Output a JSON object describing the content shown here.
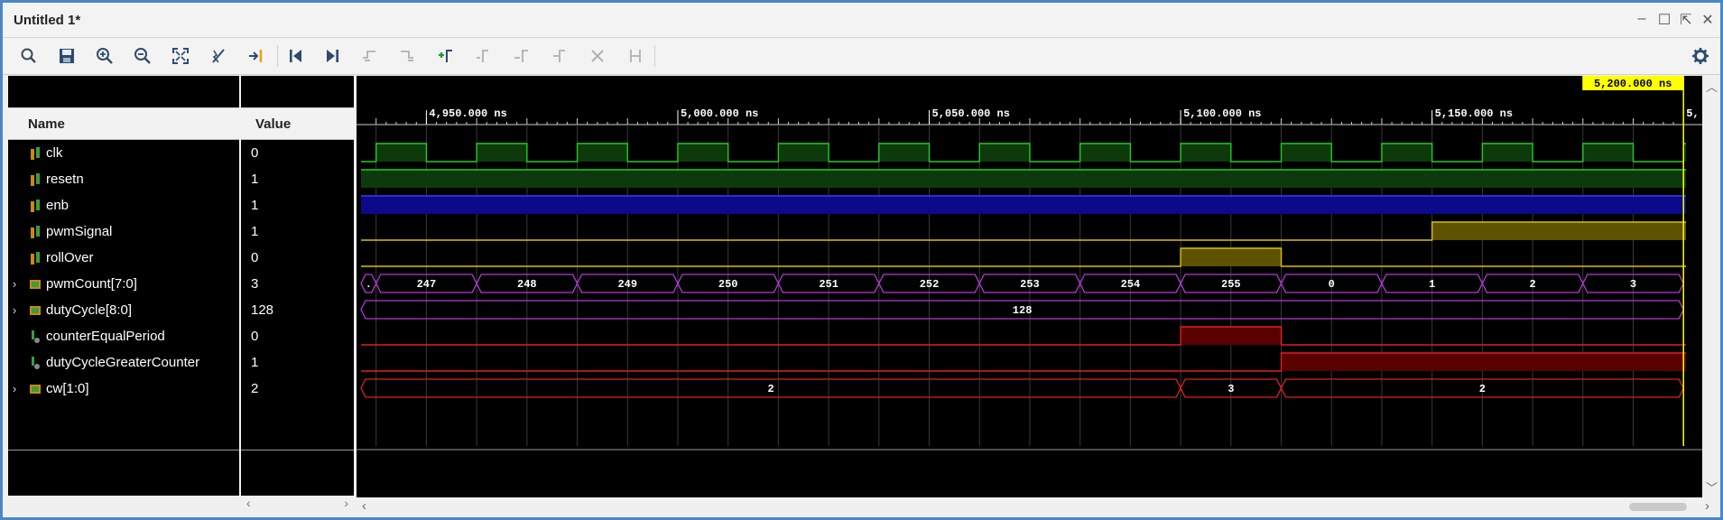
{
  "window": {
    "title": "Untitled 1*",
    "controls": {
      "minimize": "–",
      "restore": "☐",
      "popout": "⇱",
      "close": "✕"
    }
  },
  "toolbar": {
    "buttons": [
      {
        "name": "search-button",
        "icon": "search-icon"
      },
      {
        "name": "save-button",
        "icon": "save-icon"
      },
      {
        "name": "zoom-in-button",
        "icon": "zoom-in-icon"
      },
      {
        "name": "zoom-out-button",
        "icon": "zoom-out-icon"
      },
      {
        "name": "zoom-fit-button",
        "icon": "zoom-fit-icon"
      },
      {
        "name": "snap-transitions-button",
        "icon": "snap-icon"
      },
      {
        "name": "go-to-cursor-button",
        "icon": "goto-cursor-icon"
      },
      {
        "name": "go-to-time-0-button",
        "icon": "goto-start-icon"
      },
      {
        "name": "go-to-last-time-button",
        "icon": "goto-end-icon"
      },
      {
        "name": "previous-transition-button",
        "icon": "prev-transition-icon"
      },
      {
        "name": "next-transition-button",
        "icon": "next-transition-icon"
      },
      {
        "name": "add-marker-button",
        "icon": "add-marker-icon"
      },
      {
        "name": "previous-marker-button",
        "icon": "prev-marker-icon"
      },
      {
        "name": "next-marker-button",
        "icon": "next-marker-icon"
      },
      {
        "name": "swap-cursors-button",
        "icon": "swap-cursors-icon"
      },
      {
        "name": "delete-button",
        "icon": "x-icon"
      },
      {
        "name": "fix-markers-button",
        "icon": "fix-markers-icon"
      }
    ],
    "settings_icon": "gear-icon"
  },
  "panes": {
    "name_header": "Name",
    "value_header": "Value"
  },
  "signals": [
    {
      "name": "clk",
      "value": "0",
      "kind": "bit",
      "expandable": false
    },
    {
      "name": "resetn",
      "value": "1",
      "kind": "bit",
      "expandable": false
    },
    {
      "name": "enb",
      "value": "1",
      "kind": "bit",
      "expandable": false
    },
    {
      "name": "pwmSignal",
      "value": "1",
      "kind": "bit",
      "expandable": false
    },
    {
      "name": "rollOver",
      "value": "0",
      "kind": "bit",
      "expandable": false
    },
    {
      "name": "pwmCount[7:0]",
      "value": "3",
      "kind": "bus",
      "expandable": true
    },
    {
      "name": "dutyCycle[8:0]",
      "value": "128",
      "kind": "bus",
      "expandable": true
    },
    {
      "name": "counterEqualPeriod",
      "value": "0",
      "kind": "internal",
      "expandable": false
    },
    {
      "name": "dutyCycleGreaterCounter",
      "value": "1",
      "kind": "internal",
      "expandable": false
    },
    {
      "name": "cw[1:0]",
      "value": "2",
      "kind": "bus",
      "expandable": true
    }
  ],
  "timeline": {
    "unit": "ns",
    "start": 4937,
    "end": 5200.5,
    "cursor": 5200,
    "cursor_label": "5,200.000 ns",
    "major_ticks": [
      {
        "t": 4950,
        "label": "4,950.000 ns"
      },
      {
        "t": 5000,
        "label": "5,000.000 ns"
      },
      {
        "t": 5050,
        "label": "5,050.000 ns"
      },
      {
        "t": 5100,
        "label": "5,100.000 ns"
      },
      {
        "t": 5150,
        "label": "5,150.000 ns"
      },
      {
        "t": 5200,
        "label": "5,"
      }
    ]
  },
  "waves": {
    "clk": {
      "color": "#22cc22",
      "fill": "#0c3a0c",
      "period": 20,
      "high_start": 4940
    },
    "resetn": {
      "color": "#22cc22",
      "fill": "#0c3a0c",
      "level": 1
    },
    "enb": {
      "color": "#3b3bff",
      "fill": "#0a0a8a",
      "level": 1
    },
    "pwmSignal": {
      "color": "#d9c300",
      "fill": "#5e5200",
      "high_from": 5150
    },
    "rollOver": {
      "color": "#d9c300",
      "fill": "#5e5200",
      "high_from": 5100,
      "high_to": 5120
    },
    "pwmCount": {
      "color": "#b23bd6",
      "segments": [
        {
          "from": 4937,
          "to": 4940,
          "label": "."
        },
        {
          "from": 4940,
          "to": 4960,
          "label": "247"
        },
        {
          "from": 4960,
          "to": 4980,
          "label": "248"
        },
        {
          "from": 4980,
          "to": 5000,
          "label": "249"
        },
        {
          "from": 5000,
          "to": 5020,
          "label": "250"
        },
        {
          "from": 5020,
          "to": 5040,
          "label": "251"
        },
        {
          "from": 5040,
          "to": 5060,
          "label": "252"
        },
        {
          "from": 5060,
          "to": 5080,
          "label": "253"
        },
        {
          "from": 5080,
          "to": 5100,
          "label": "254"
        },
        {
          "from": 5100,
          "to": 5120,
          "label": "255"
        },
        {
          "from": 5120,
          "to": 5140,
          "label": "0"
        },
        {
          "from": 5140,
          "to": 5160,
          "label": "1"
        },
        {
          "from": 5160,
          "to": 5180,
          "label": "2"
        },
        {
          "from": 5180,
          "to": 5200,
          "label": "3"
        }
      ]
    },
    "dutyCycle": {
      "color": "#b23bd6",
      "segments": [
        {
          "from": 4937,
          "to": 5200,
          "label": "128"
        }
      ]
    },
    "counterEqualPeriod": {
      "color": "#e02020",
      "fill": "#5a0000",
      "high_from": 5100,
      "high_to": 5120
    },
    "dutyCycleGreaterCounter": {
      "color": "#e02020",
      "fill": "#5a0000",
      "high_from": 5120
    },
    "cw": {
      "color": "#e02020",
      "segments": [
        {
          "from": 4937,
          "to": 5100,
          "label": "2"
        },
        {
          "from": 5100,
          "to": 5120,
          "label": "3"
        },
        {
          "from": 5120,
          "to": 5200,
          "label": "2"
        }
      ]
    }
  }
}
